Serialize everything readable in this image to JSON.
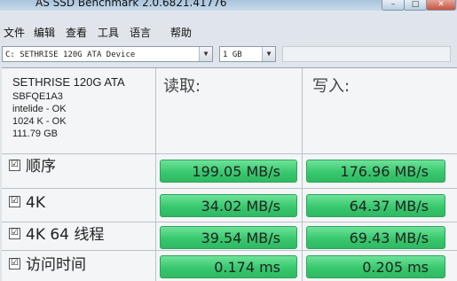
{
  "window": {
    "title": "AS SSD Benchmark 2.0.6821.41776",
    "min_glyph": "–",
    "max_glyph": "□",
    "close_glyph": "✕"
  },
  "menu": {
    "file": "文件",
    "edit": "编辑",
    "view": "查看",
    "tools": "工具",
    "language": "语言",
    "help": "帮助"
  },
  "toolbar": {
    "drive_value": "C: SETHRISE 120G ATA Device",
    "size_value": "1 GB",
    "arrow_glyph": "▼"
  },
  "device": {
    "name": "SETHRISE 120G ATA",
    "lines": [
      "SBFQE1A3",
      "intelide - OK",
      "1024 K - OK",
      "111.79 GB"
    ]
  },
  "columns": {
    "read": "读取:",
    "write": "写入:"
  },
  "check_glyph": "☑",
  "rows": [
    {
      "label": "顺序",
      "read": "199.05 MB/s",
      "write": "176.96 MB/s"
    },
    {
      "label": "4K",
      "read": "34.02 MB/s",
      "write": "64.37 MB/s"
    },
    {
      "label": "4K 64 线程",
      "read": "39.54 MB/s",
      "write": "69.43 MB/s"
    },
    {
      "label": "访问时间",
      "read": "0.174 ms",
      "write": "0.205 ms"
    }
  ]
}
